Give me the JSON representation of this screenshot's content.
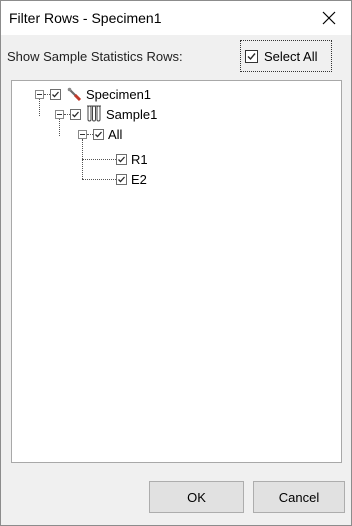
{
  "window": {
    "title": "Filter Rows - Specimen1"
  },
  "header": {
    "stats_label": "Show Sample Statistics Rows:",
    "select_all_label": "Select All",
    "select_all_checked": true
  },
  "tree": {
    "nodes": [
      {
        "label": "Specimen1",
        "icon": "specimen-icon",
        "checked": true,
        "expanded": true,
        "level": 0
      },
      {
        "label": "Sample1",
        "icon": "sample-tubes-icon",
        "checked": true,
        "expanded": true,
        "level": 1
      },
      {
        "label": "All",
        "icon": "",
        "checked": true,
        "expanded": true,
        "level": 2
      },
      {
        "label": "R1",
        "icon": "",
        "checked": true,
        "level": 3
      },
      {
        "label": "E2",
        "icon": "",
        "checked": true,
        "level": 3
      }
    ]
  },
  "footer": {
    "ok_label": "OK",
    "cancel_label": "Cancel"
  },
  "colors": {
    "dialog_bg": "#f0f0f0",
    "panel_bg": "#ffffff",
    "button_bg": "#e1e1e1",
    "check_color": "#2a2a2a"
  }
}
